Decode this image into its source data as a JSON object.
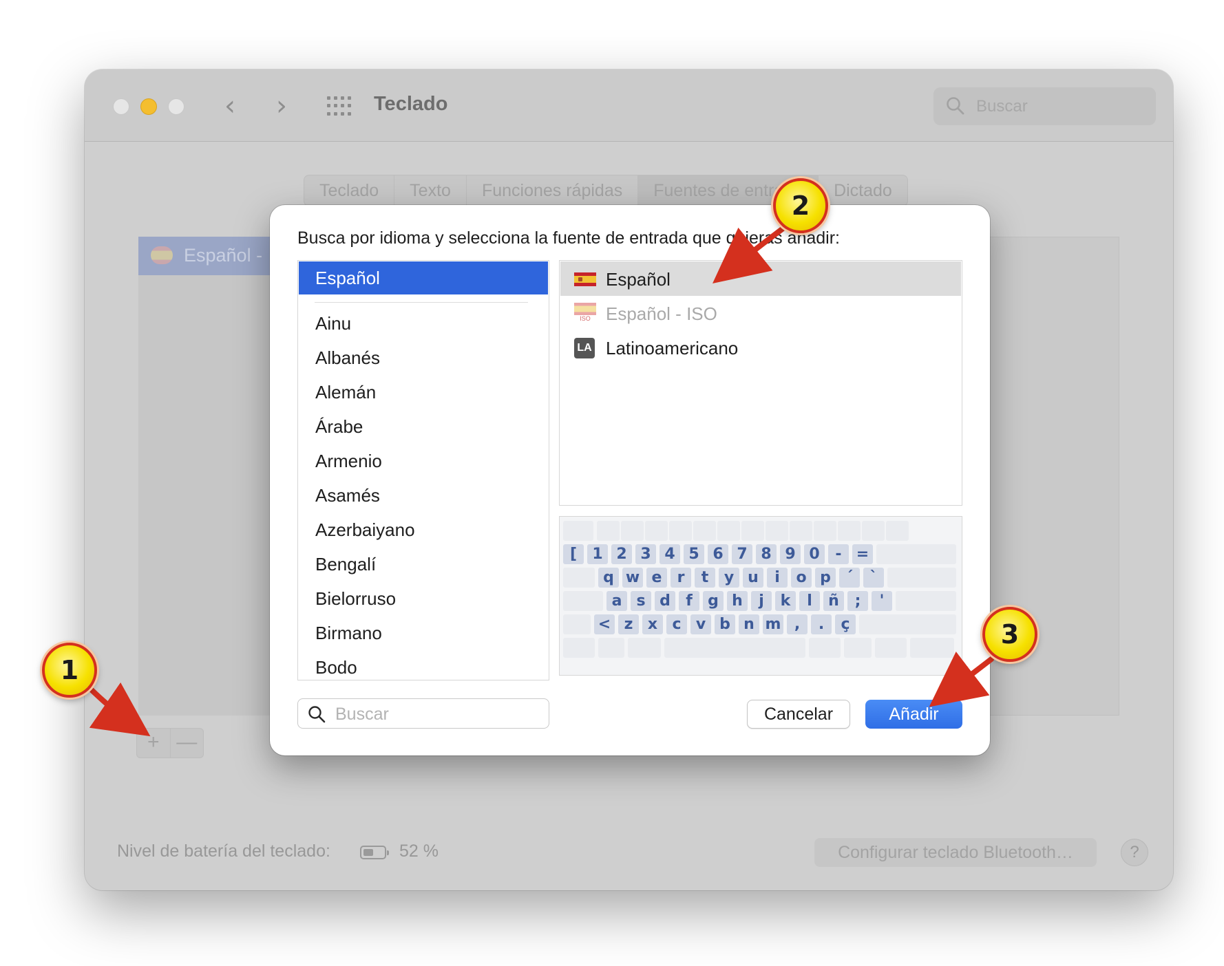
{
  "window": {
    "title": "Teclado",
    "search_placeholder": "Buscar",
    "nav_back": "‹",
    "nav_forward": "›",
    "tabs": [
      {
        "label": "Teclado"
      },
      {
        "label": "Texto"
      },
      {
        "label": "Funciones rápidas"
      },
      {
        "label": "Fuentes de entrada"
      },
      {
        "label": "Dictado"
      }
    ],
    "input_source_item": "Español -",
    "add_label": "+",
    "remove_label": "—",
    "battery_label": "Nivel de batería del teclado:",
    "battery_value": "52 %",
    "battery_level": 0.52,
    "bluetooth_button": "Configurar teclado Bluetooth…",
    "help": "?"
  },
  "sheet": {
    "prompt": "Busca por idioma y selecciona la fuente de entrada que quieras añadir:",
    "selected_language": "Español",
    "languages": [
      "Ainu",
      "Albanés",
      "Alemán",
      "Árabe",
      "Armenio",
      "Asamés",
      "Azerbaiyano",
      "Bengalí",
      "Bielorruso",
      "Birmano",
      "Bodo"
    ],
    "sources": [
      {
        "label": "Español",
        "icon": "spain-flag-icon",
        "state": "selected"
      },
      {
        "label": "Español - ISO",
        "icon": "spain-iso-flag-icon",
        "state": "disabled",
        "badge": "ISO"
      },
      {
        "label": "Latinoamericano",
        "icon": "la-badge-icon",
        "state": "normal",
        "badge": "LA"
      }
    ],
    "keyboard_rows": [
      [
        "[",
        "1",
        "2",
        "3",
        "4",
        "5",
        "6",
        "7",
        "8",
        "9",
        "0",
        "-",
        "="
      ],
      [
        "q",
        "w",
        "e",
        "r",
        "t",
        "y",
        "u",
        "i",
        "o",
        "p",
        "´",
        "`"
      ],
      [
        "a",
        "s",
        "d",
        "f",
        "g",
        "h",
        "j",
        "k",
        "l",
        "ñ",
        ";",
        "'"
      ],
      [
        "<",
        "z",
        "x",
        "c",
        "v",
        "b",
        "n",
        "m",
        ",",
        ".",
        "ç"
      ]
    ],
    "search_placeholder": "Buscar",
    "cancel_label": "Cancelar",
    "add_label": "Añadir"
  },
  "annotations": [
    {
      "label": "1"
    },
    {
      "label": "2"
    },
    {
      "label": "3"
    }
  ],
  "colors": {
    "accent": "#2f65dc",
    "callout": "#f6e100",
    "arrow": "#d4301e"
  }
}
